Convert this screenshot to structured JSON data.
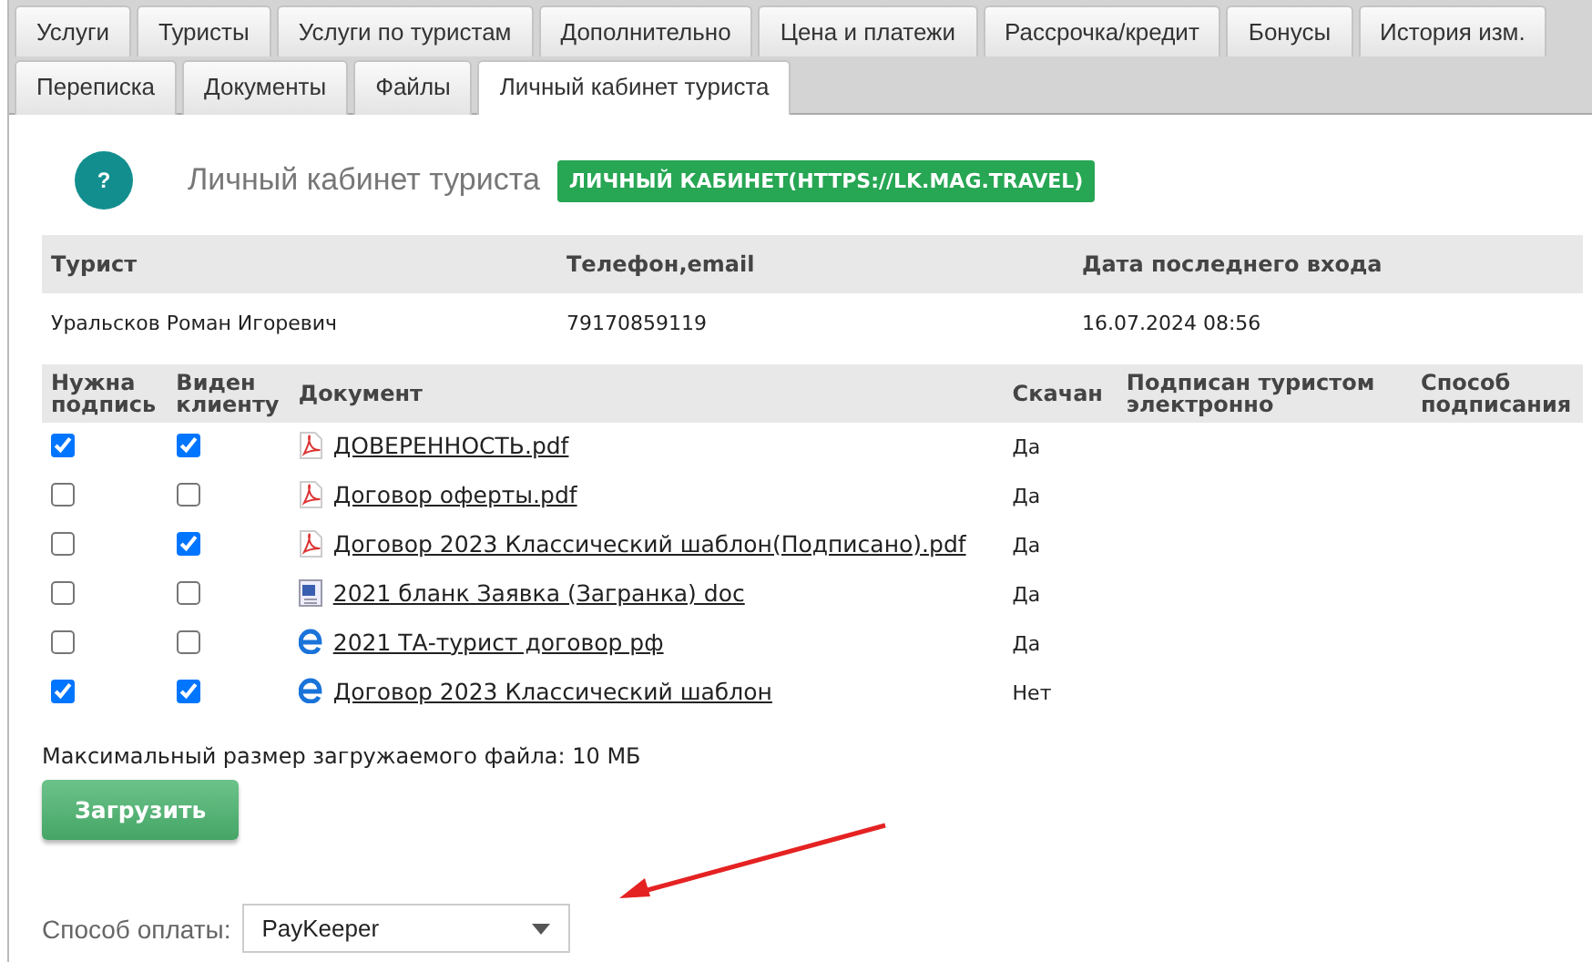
{
  "tabs_row_1": [
    {
      "label": "Услуги",
      "selected": false
    },
    {
      "label": "Туристы",
      "selected": false
    },
    {
      "label": "Услуги по туристам",
      "selected": false
    },
    {
      "label": "Дополнительно",
      "selected": false
    },
    {
      "label": "Цена и платежи",
      "selected": false
    },
    {
      "label": "Рассрочка/кредит",
      "selected": false
    },
    {
      "label": "Бонусы",
      "selected": false
    },
    {
      "label": "История изм.",
      "selected": false
    }
  ],
  "tabs_row_2": [
    {
      "label": "Переписка",
      "selected": false
    },
    {
      "label": "Документы",
      "selected": false
    },
    {
      "label": "Файлы",
      "selected": false
    },
    {
      "label": "Личный кабинет туриста",
      "selected": true
    }
  ],
  "help_badge": "?",
  "section_title": "Личный кабинет туриста",
  "cabinet_link": "ЛИЧНЫЙ КАБИНЕТ(HTTPS://LK.MAG.TRAVEL)",
  "tourists_table": {
    "columns": [
      "Турист",
      "Телефон,email",
      "Дата последнего входа"
    ],
    "rows": [
      [
        "Уральсков Роман Игоревич",
        "79170859119",
        "16.07.2024 08:56"
      ]
    ]
  },
  "documents_table": {
    "columns": [
      "Нужна подпись",
      "Виден клиенту",
      "Документ",
      "Скачан",
      "Подписан туристом электронно",
      "Способ подписания"
    ],
    "rows": [
      {
        "signature_required": true,
        "visible_to_client": true,
        "kind": "pdf",
        "document": "ДОВЕРЕННОСТЬ.pdf",
        "downloaded": "Да"
      },
      {
        "signature_required": false,
        "visible_to_client": false,
        "kind": "pdf",
        "document": "Договор оферты.pdf",
        "downloaded": "Да"
      },
      {
        "signature_required": false,
        "visible_to_client": true,
        "kind": "pdf",
        "document": "Договор 2023 Классический шаблон(Подписано).pdf",
        "downloaded": "Да"
      },
      {
        "signature_required": false,
        "visible_to_client": false,
        "kind": "doc",
        "document": "2021 бланк Заявка (Загранка) doc",
        "downloaded": "Да"
      },
      {
        "signature_required": false,
        "visible_to_client": false,
        "kind": "web",
        "document": "2021 ТА-турист договор рф",
        "downloaded": "Да"
      },
      {
        "signature_required": true,
        "visible_to_client": true,
        "kind": "web",
        "document": "Договор 2023 Классический шаблон",
        "downloaded": "Нет"
      }
    ]
  },
  "max_file_size_note": "Максимальный размер загружаемого файла: 10 МБ",
  "upload_button": "Загрузить",
  "payment_method": {
    "label": "Способ оплаты:",
    "value": "PayKeeper"
  }
}
